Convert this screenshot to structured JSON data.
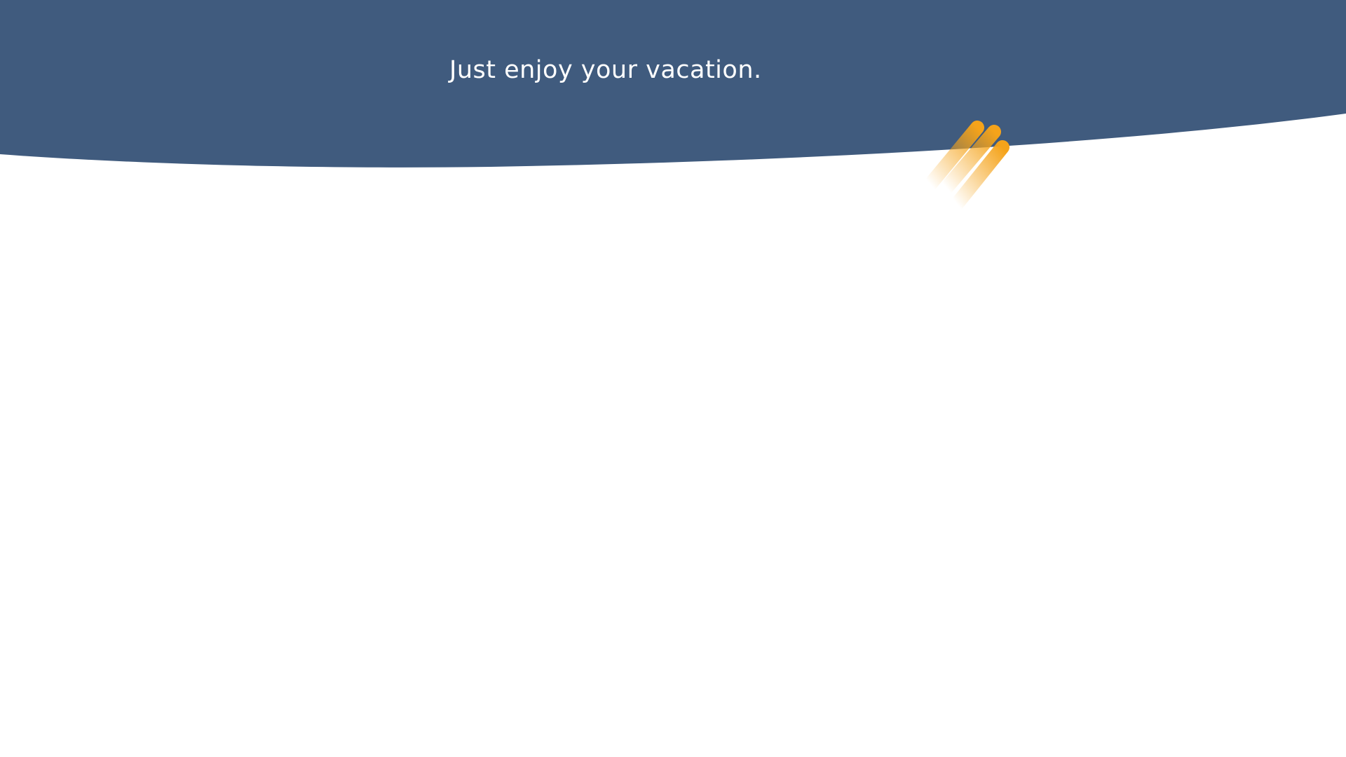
{
  "hero": {
    "tagline": "Just enjoy your vacation.",
    "background_color": "#405B7E",
    "text_color": "#FFFFFF"
  },
  "decoration": {
    "icon": "speed-stripes-icon",
    "accent_color": "#F5A31A"
  },
  "page": {
    "background_color": "#FFFFFF"
  }
}
